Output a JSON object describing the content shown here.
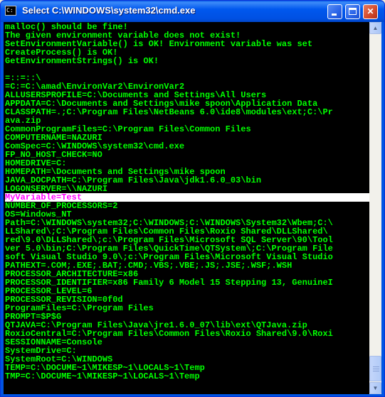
{
  "window": {
    "title": "Select C:\\WINDOWS\\system32\\cmd.exe",
    "buttons": {
      "minimize": "",
      "maximize": "",
      "close": "✕"
    },
    "colors": {
      "text": "#00ff00",
      "background": "#000000",
      "highlight_bg": "#ffffff",
      "highlight_text": "#ff00ff"
    }
  },
  "scrollbar": {
    "up": "▲",
    "down": "▼"
  },
  "console": {
    "highlight_index": 23,
    "lines": [
      "malloc() should be fine!",
      "The given environment variable does not exist!",
      "SetEnvironmentVariable() is OK! Environment variable was set",
      "CreateProcess() is OK!",
      "GetEnvironmentStrings() is OK!",
      "",
      "=::=::\\",
      "=C:=C:\\amad\\EnvironVar2\\EnvironVar2",
      "ALLUSERSPROFILE=C:\\Documents and Settings\\All Users",
      "APPDATA=C:\\Documents and Settings\\mike spoon\\Application Data",
      "CLASSPATH=.;C:\\Program Files\\NetBeans 6.0\\ide8\\modules\\ext;C:\\Pr",
      "ava.zip",
      "CommonProgramFiles=C:\\Program Files\\Common Files",
      "COMPUTERNAME=NAZURI",
      "ComSpec=C:\\WINDOWS\\system32\\cmd.exe",
      "FP_NO_HOST_CHECK=NO",
      "HOMEDRIVE=C:",
      "HOMEPATH=\\Documents and Settings\\mike spoon",
      "JAVA_DOCPATH=C:\\Program Files\\Java\\jdk1.6.0_03\\bin",
      "LOGONSERVER=\\\\NAZURI",
      "MyVariable=Test",
      "NUMBER_OF_PROCESSORS=2",
      "OS=Windows_NT",
      "Path=C:\\WINDOWS\\system32;C:\\WINDOWS;C:\\WINDOWS\\System32\\Wbem;C:\\",
      "LLShared\\;C:\\Program Files\\Common Files\\Roxio Shared\\DLLShared\\",
      "red\\9.0\\DLLShared\\;c:\\Program Files\\Microsoft SQL Server\\90\\Tool",
      "ver 5.0\\bin;C:\\Program Files\\QuickTime\\QTSystem\\;C:\\Program File",
      "soft Visual Studio 9.0\\;c:\\Program Files\\Microsoft Visual Studio",
      "PATHEXT=.COM;.EXE;.BAT;.CMD;.VBS;.VBE;.JS;.JSE;.WSF;.WSH",
      "PROCESSOR_ARCHITECTURE=x86",
      "PROCESSOR_IDENTIFIER=x86 Family 6 Model 15 Stepping 13, GenuineI",
      "PROCESSOR_LEVEL=6",
      "PROCESSOR_REVISION=0f0d",
      "ProgramFiles=C:\\Program Files",
      "PROMPT=$P$G",
      "QTJAVA=C:\\Program Files\\Java\\jre1.6.0_07\\lib\\ext\\QTJava.zip",
      "RoxioCentral=C:\\Program Files\\Common Files\\Roxio Shared\\9.0\\Roxi",
      "SESSIONNAME=Console",
      "SystemDrive=C:",
      "SystemRoot=C:\\WINDOWS",
      "TEMP=C:\\DOCUME~1\\MIKESP~1\\LOCALS~1\\Temp",
      "TMP=C:\\DOCUME~1\\MIKESP~1\\LOCALS~1\\Temp"
    ]
  }
}
